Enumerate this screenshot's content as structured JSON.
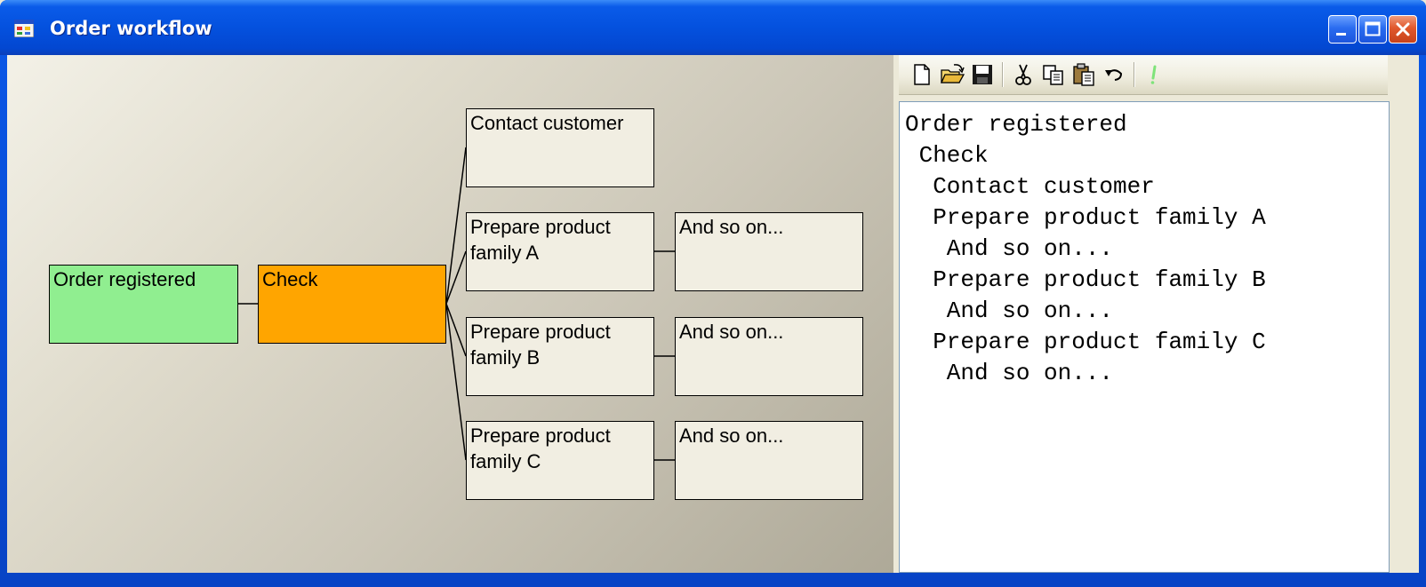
{
  "window": {
    "title": "Order workflow",
    "icon": "app-window-icon",
    "controls": [
      "minimize-icon",
      "maximize-icon",
      "close-icon"
    ]
  },
  "colors": {
    "registered_node": "#90ee90",
    "check_node": "#ffa500",
    "default_node": "#f1eee2",
    "titlebar": "#0451de"
  },
  "diagram": {
    "nodes": {
      "order_registered": "Order registered",
      "check": "Check",
      "contact_customer": "Contact customer",
      "prepare_a": "Prepare product family A",
      "prepare_b": "Prepare product family B",
      "prepare_c": "Prepare product family C",
      "and_so_on_a": "And so on...",
      "and_so_on_b": "And so on...",
      "and_so_on_c": "And so on..."
    }
  },
  "toolbar": {
    "buttons": [
      "new-file-icon",
      "open-folder-icon",
      "save-icon",
      "cut-icon",
      "copy-icon",
      "paste-icon",
      "undo-icon",
      "run-icon"
    ]
  },
  "outline": {
    "lines": [
      "Order registered",
      " Check",
      "  Contact customer",
      "  Prepare product family A",
      "   And so on...",
      "  Prepare product family B",
      "   And so on...",
      "  Prepare product family C",
      "   And so on..."
    ]
  }
}
